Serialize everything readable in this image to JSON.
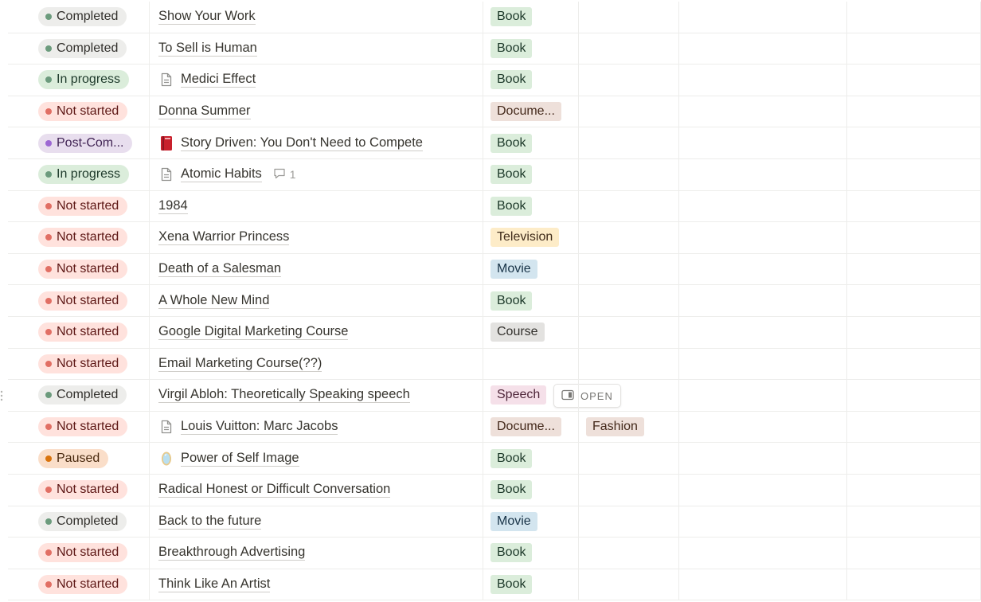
{
  "rows": [
    {
      "status": "Completed",
      "status_kind": "completed",
      "name": "Show Your Work",
      "icon": "",
      "type": "Book",
      "type_color": "#dbeddb",
      "type_text": "#1c3829",
      "tag": ""
    },
    {
      "status": "Completed",
      "status_kind": "completed",
      "name": "To Sell is Human",
      "icon": "",
      "type": "Book",
      "type_color": "#dbeddb",
      "type_text": "#1c3829",
      "tag": ""
    },
    {
      "status": "In progress",
      "status_kind": "progress",
      "name": "Medici Effect",
      "icon": "page-icon",
      "type": "Book",
      "type_color": "#dbeddb",
      "type_text": "#1c3829",
      "tag": ""
    },
    {
      "status": "Not started",
      "status_kind": "notstarted",
      "name": "Donna Summer",
      "icon": "",
      "type": "Docume...",
      "type_color": "#eee0da",
      "type_text": "#44291b",
      "tag": ""
    },
    {
      "status": "Post-Com...",
      "status_kind": "post",
      "name": "Story Driven: You Don't Need to Compete",
      "icon": "red-book-icon",
      "type": "Book",
      "type_color": "#dbeddb",
      "type_text": "#1c3829",
      "tag": ""
    },
    {
      "status": "In progress",
      "status_kind": "progress",
      "name": "Atomic Habits",
      "icon": "page-icon",
      "comment_count": "1",
      "type": "Book",
      "type_color": "#dbeddb",
      "type_text": "#1c3829",
      "tag": ""
    },
    {
      "status": "Not started",
      "status_kind": "notstarted",
      "name": "1984",
      "icon": "",
      "type": "Book",
      "type_color": "#dbeddb",
      "type_text": "#1c3829",
      "tag": ""
    },
    {
      "status": "Not started",
      "status_kind": "notstarted",
      "name": "Xena Warrior Princess",
      "icon": "",
      "type": "Television",
      "type_color": "#fdecc8",
      "type_text": "#402c1b",
      "tag": ""
    },
    {
      "status": "Not started",
      "status_kind": "notstarted",
      "name": "Death of a Salesman",
      "icon": "",
      "type": "Movie",
      "type_color": "#d3e5ef",
      "type_text": "#183347",
      "tag": ""
    },
    {
      "status": "Not started",
      "status_kind": "notstarted",
      "name": "A Whole New Mind",
      "icon": "",
      "type": "Book",
      "type_color": "#dbeddb",
      "type_text": "#1c3829",
      "tag": ""
    },
    {
      "status": "Not started",
      "status_kind": "notstarted",
      "name": "Google Digital Marketing Course",
      "icon": "",
      "type": "Course",
      "type_color": "#e3e2e0",
      "type_text": "#32302c",
      "tag": ""
    },
    {
      "status": "Not started",
      "status_kind": "notstarted",
      "name": "Email Marketing Course(??)",
      "icon": "",
      "type": "",
      "type_color": "",
      "type_text": "",
      "tag": ""
    },
    {
      "status": "Completed",
      "status_kind": "completed",
      "name": "Virgil Abloh: Theoretically Speaking speech",
      "icon": "",
      "open_label": "OPEN",
      "type": "Speech",
      "type_color": "#f5e0e9",
      "type_text": "#4c2337",
      "tag": ""
    },
    {
      "status": "Not started",
      "status_kind": "notstarted",
      "name": "Louis Vuitton: Marc Jacobs",
      "icon": "page-icon",
      "type": "Docume...",
      "type_color": "#eee0da",
      "type_text": "#44291b",
      "tag": "Fashion",
      "tag_color": "#eee0da",
      "tag_text": "#44291b"
    },
    {
      "status": "Paused",
      "status_kind": "paused",
      "name": "Power of Self Image",
      "icon": "mirror-icon",
      "type": "Book",
      "type_color": "#dbeddb",
      "type_text": "#1c3829",
      "tag": ""
    },
    {
      "status": "Not started",
      "status_kind": "notstarted",
      "name": "Radical Honest or Difficult Conversation",
      "icon": "",
      "type": "Book",
      "type_color": "#dbeddb",
      "type_text": "#1c3829",
      "tag": ""
    },
    {
      "status": "Completed",
      "status_kind": "completed",
      "name": "Back to the future",
      "icon": "",
      "type": "Movie",
      "type_color": "#d3e5ef",
      "type_text": "#183347",
      "tag": ""
    },
    {
      "status": "Not started",
      "status_kind": "notstarted",
      "name": "Breakthrough Advertising",
      "icon": "",
      "type": "Book",
      "type_color": "#dbeddb",
      "type_text": "#1c3829",
      "tag": ""
    },
    {
      "status": "Not started",
      "status_kind": "notstarted",
      "name": "Think Like An Artist",
      "icon": "",
      "type": "Book",
      "type_color": "#dbeddb",
      "type_text": "#1c3829",
      "tag": ""
    }
  ]
}
